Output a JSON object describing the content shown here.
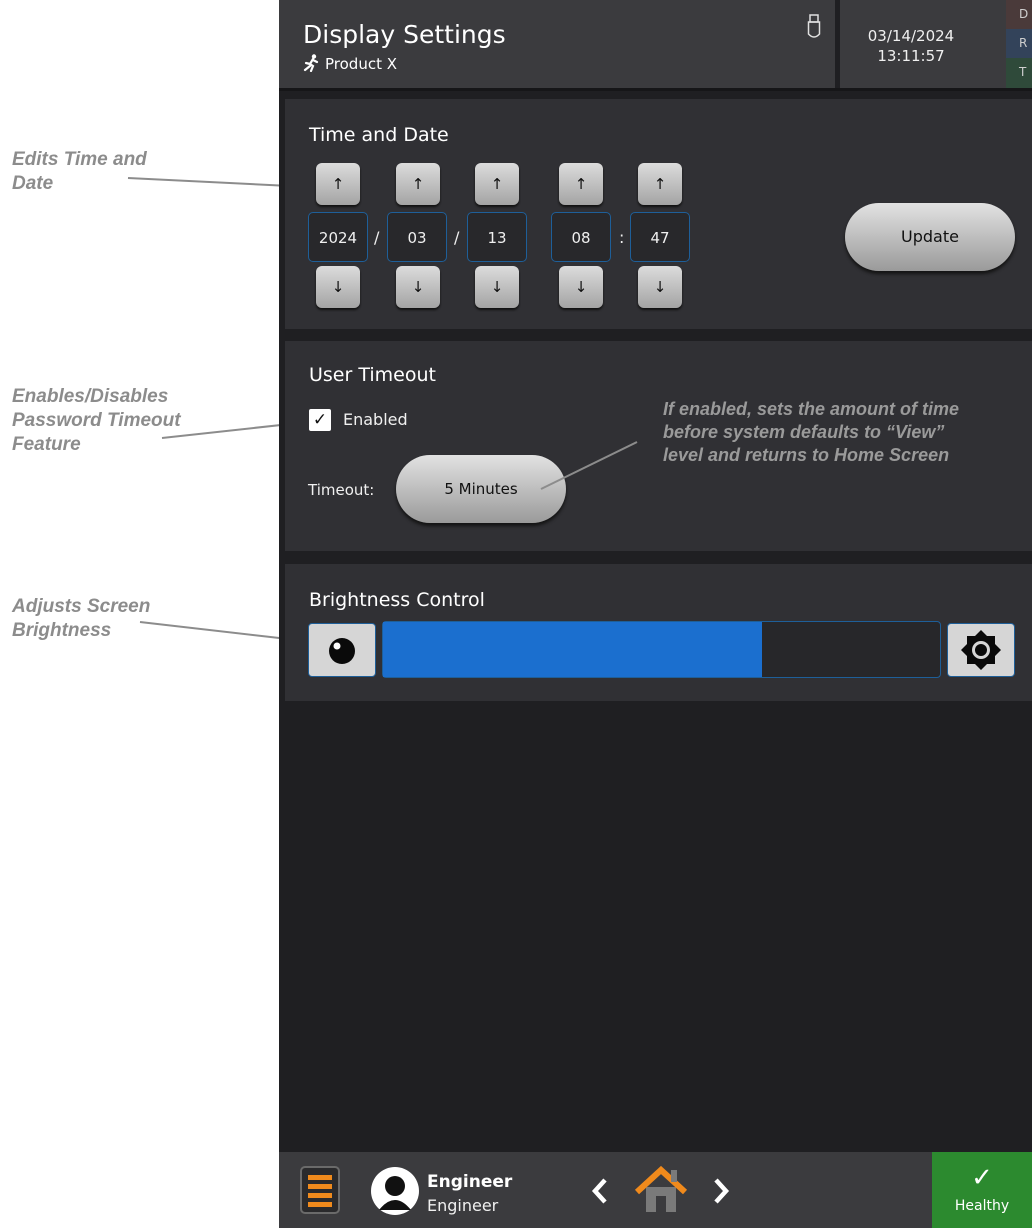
{
  "annotations": {
    "time_date": "Edits Time and Date",
    "timeout": "Enables/Disables Password Timeout Feature",
    "brightness": "Adjusts Screen Brightness",
    "timeout_note": "If enabled, sets the amount of time before system defaults to “View” level and returns to Home Screen"
  },
  "header": {
    "title": "Display Settings",
    "subtitle": "Product X",
    "date": "03/14/2024",
    "time": "13:11:57",
    "tags": [
      "D",
      "R",
      "T"
    ],
    "tag_colors": [
      "#4a3a3a",
      "#33435a",
      "#2f4a3a"
    ]
  },
  "time_and_date": {
    "title": "Time and Date",
    "up_label": "↑",
    "down_label": "↓",
    "year": "2024",
    "month": "03",
    "day": "13",
    "hour": "08",
    "minute": "47",
    "sep_slash": "/",
    "sep_colon": ":",
    "update_label": "Update"
  },
  "user_timeout": {
    "title": "User Timeout",
    "checkbox_mark": "✓",
    "enabled_label": "Enabled",
    "timeout_label": "Timeout:",
    "timeout_value": "5 Minutes"
  },
  "brightness": {
    "title": "Brightness Control",
    "level": 0.68,
    "accent": "#1b6fcf"
  },
  "footer": {
    "user_name": "Engineer",
    "user_role": "Engineer",
    "status": "Healthy",
    "status_mark": "✓",
    "status_color": "#2c8a2f"
  },
  "icons": [
    "usb-icon",
    "runner-icon",
    "menu-icon",
    "user-avatar-icon",
    "chevron-left-icon",
    "home-icon",
    "chevron-right-icon",
    "brightness-low-icon",
    "brightness-high-icon",
    "check-icon"
  ]
}
